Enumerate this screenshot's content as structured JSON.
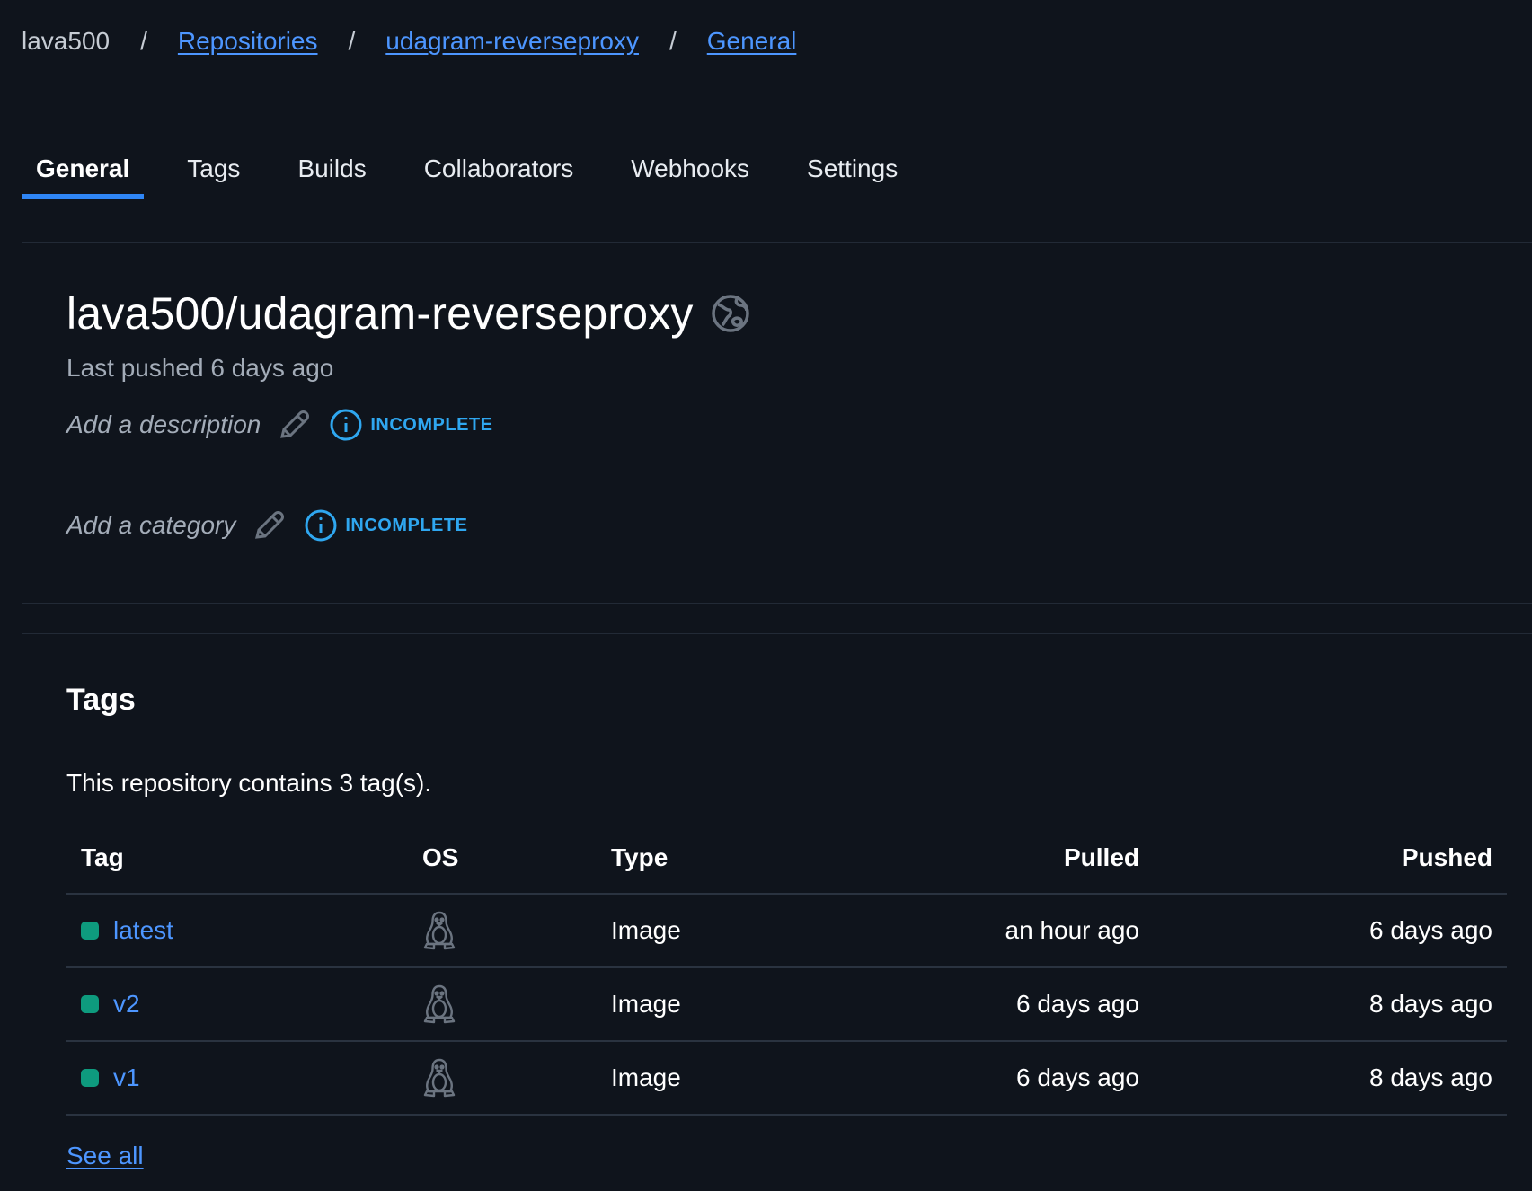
{
  "breadcrumb": {
    "owner": "lava500",
    "separator": "/",
    "repositories": "Repositories",
    "repository": "udagram-reverseproxy",
    "current": "General"
  },
  "tabs": [
    {
      "label": "General",
      "active": true
    },
    {
      "label": "Tags",
      "active": false
    },
    {
      "label": "Builds",
      "active": false
    },
    {
      "label": "Collaborators",
      "active": false
    },
    {
      "label": "Webhooks",
      "active": false
    },
    {
      "label": "Settings",
      "active": false
    }
  ],
  "repo": {
    "title": "lava500/udagram-reverseproxy",
    "visibility_icon": "globe-icon",
    "last_pushed": "Last pushed 6 days ago",
    "description_placeholder": "Add a description",
    "category_placeholder": "Add a category",
    "incomplete_label": "INCOMPLETE"
  },
  "tags_section": {
    "heading": "Tags",
    "summary": "This repository contains 3 tag(s).",
    "columns": {
      "tag": "Tag",
      "os": "OS",
      "type": "Type",
      "pulled": "Pulled",
      "pushed": "Pushed"
    },
    "rows": [
      {
        "tag": "latest",
        "os_icon": "linux-icon",
        "type": "Image",
        "pulled": "an hour ago",
        "pushed": "6 days ago"
      },
      {
        "tag": "v2",
        "os_icon": "linux-icon",
        "type": "Image",
        "pulled": "6 days ago",
        "pushed": "8 days ago"
      },
      {
        "tag": "v1",
        "os_icon": "linux-icon",
        "type": "Image",
        "pulled": "6 days ago",
        "pushed": "8 days ago"
      }
    ],
    "see_all": "See all"
  },
  "colors": {
    "background": "#0f141c",
    "link": "#4d96ff",
    "active_tab_indicator": "#2f86f6",
    "incomplete": "#2fa7f0",
    "tag_status": "#0e9b7e"
  }
}
